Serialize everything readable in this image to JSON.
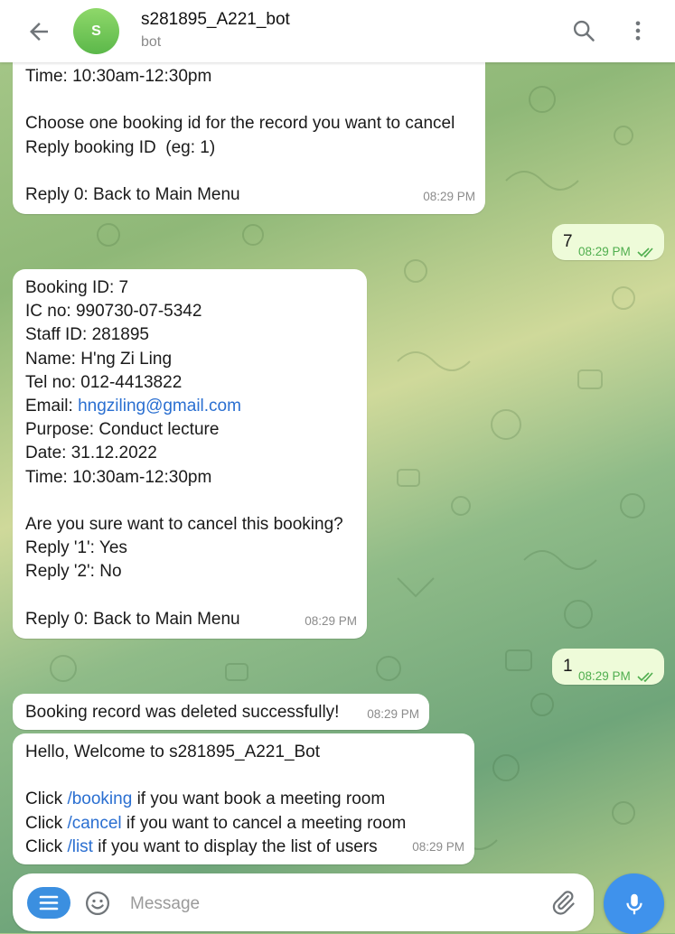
{
  "header": {
    "avatar_letter": "S",
    "title": "s281895_A221_bot",
    "subtitle": "bot"
  },
  "messages": [
    {
      "lines": [
        "Time: 10:30am-12:30pm",
        "",
        "Choose one booking id for the record you want to cancel",
        "Reply booking ID  (eg: 1)",
        "",
        "Reply 0: Back to Main Menu"
      ],
      "time": "08:29 PM"
    },
    {
      "text": "7",
      "time": "08:29 PM"
    },
    {
      "lines": [
        "Booking ID: 7",
        "IC no: 990730-07-5342",
        "Staff ID: 281895",
        "Name: H'ng Zi Ling",
        "Tel no: 012-4413822"
      ],
      "email_label": "Email: ",
      "email": "hngziling@gmail.com",
      "lines2": [
        "Purpose: Conduct lecture",
        "Date: 31.12.2022",
        "Time: 10:30am-12:30pm",
        "",
        "Are you sure want to cancel this booking?",
        "Reply '1': Yes",
        "Reply '2': No",
        "",
        "Reply 0: Back to Main Menu"
      ],
      "time": "08:29 PM"
    },
    {
      "text": "1",
      "time": "08:29 PM"
    },
    {
      "text": "Booking record was deleted successfully!",
      "time": "08:29 PM"
    },
    {
      "line1": "Hello, Welcome to s281895_A221_Bot",
      "cmd1_pre": "Click ",
      "cmd1": "/booking",
      "cmd1_post": " if you want book a meeting room",
      "cmd2_pre": "Click ",
      "cmd2": "/cancel",
      "cmd2_post": " if you want to cancel a meeting room",
      "cmd3_pre": "Click ",
      "cmd3": "/list",
      "cmd3_post": " if you want to display the list of users",
      "time": "08:29 PM"
    }
  ],
  "composer": {
    "placeholder": "Message"
  },
  "colors": {
    "accent": "#3f92ec",
    "link": "#2a6fd1",
    "outgoing_bubble": "#eefbd9",
    "read_tick": "#4fae4e"
  }
}
